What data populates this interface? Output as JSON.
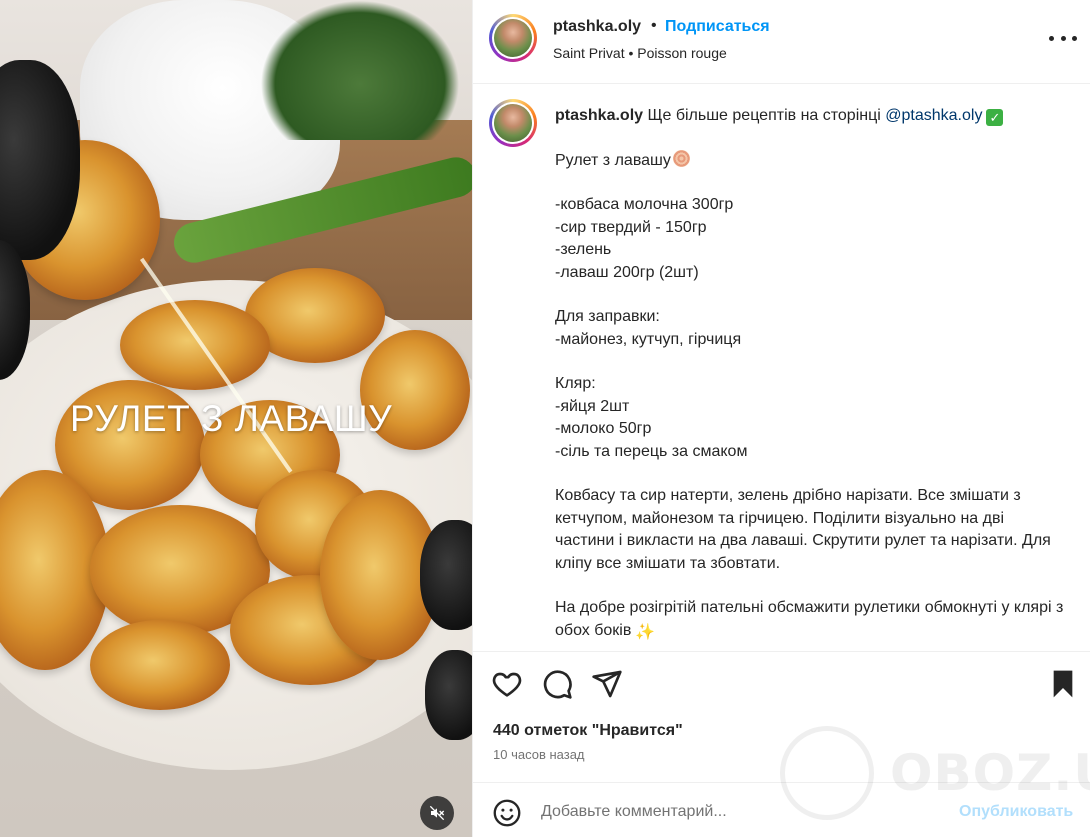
{
  "media": {
    "overlay_title": "РУЛЕТ З ЛАВАШУ",
    "mute_icon": "speaker-muted-icon"
  },
  "header": {
    "username": "ptashka.oly",
    "separator": "•",
    "follow_label": "Подписаться",
    "location": "Saint Privat",
    "audio_separator": "•",
    "audio": "Poisson rouge",
    "more_icon": "more-options-icon"
  },
  "caption": {
    "username": "ptashka.oly",
    "intro": "Ще більше рецептів на сторінці",
    "mention": "@ptashka.oly",
    "title": "Рулет з лавашу",
    "ingredients": "-ковбаса молочна 300гр\n-сир твердий - 150гр\n-зелень\n-лаваш 200гр (2шт)",
    "dressing": "Для заправки:\n-майонез, кутчуп, гірчиця",
    "batter": "Кляр:\n-яйця 2шт\n-молоко 50гр\n-сіль та перець за смаком",
    "step1": "Ковбасу та сир натерти, зелень дрібно нарізати. Все змішати з кетчупом, майонезом та гірчицею. Поділити візуально на дві частини і викласти на два лаваші. Скрутити рулет та нарізати. Для кліпу все змішати та збовтати.",
    "step2": "На добре розігрітій пательні обсмажити рулетики обмокнуті у клярі з обох боків"
  },
  "actions": {
    "icons": [
      "heart-icon",
      "comment-icon",
      "share-icon",
      "bookmark-icon"
    ],
    "likes": "440 отметок \"Нравится\"",
    "time": "10 часов назад",
    "comment_placeholder": "Добавьте комментарий...",
    "publish_label": "Опубликовать"
  },
  "watermark": {
    "text": "OBOZ.UA"
  },
  "colors": {
    "link_blue": "#0095f6",
    "publish_disabled": "#b2dffc",
    "mention": "#00376b",
    "text": "#262626",
    "muted": "#737373"
  }
}
